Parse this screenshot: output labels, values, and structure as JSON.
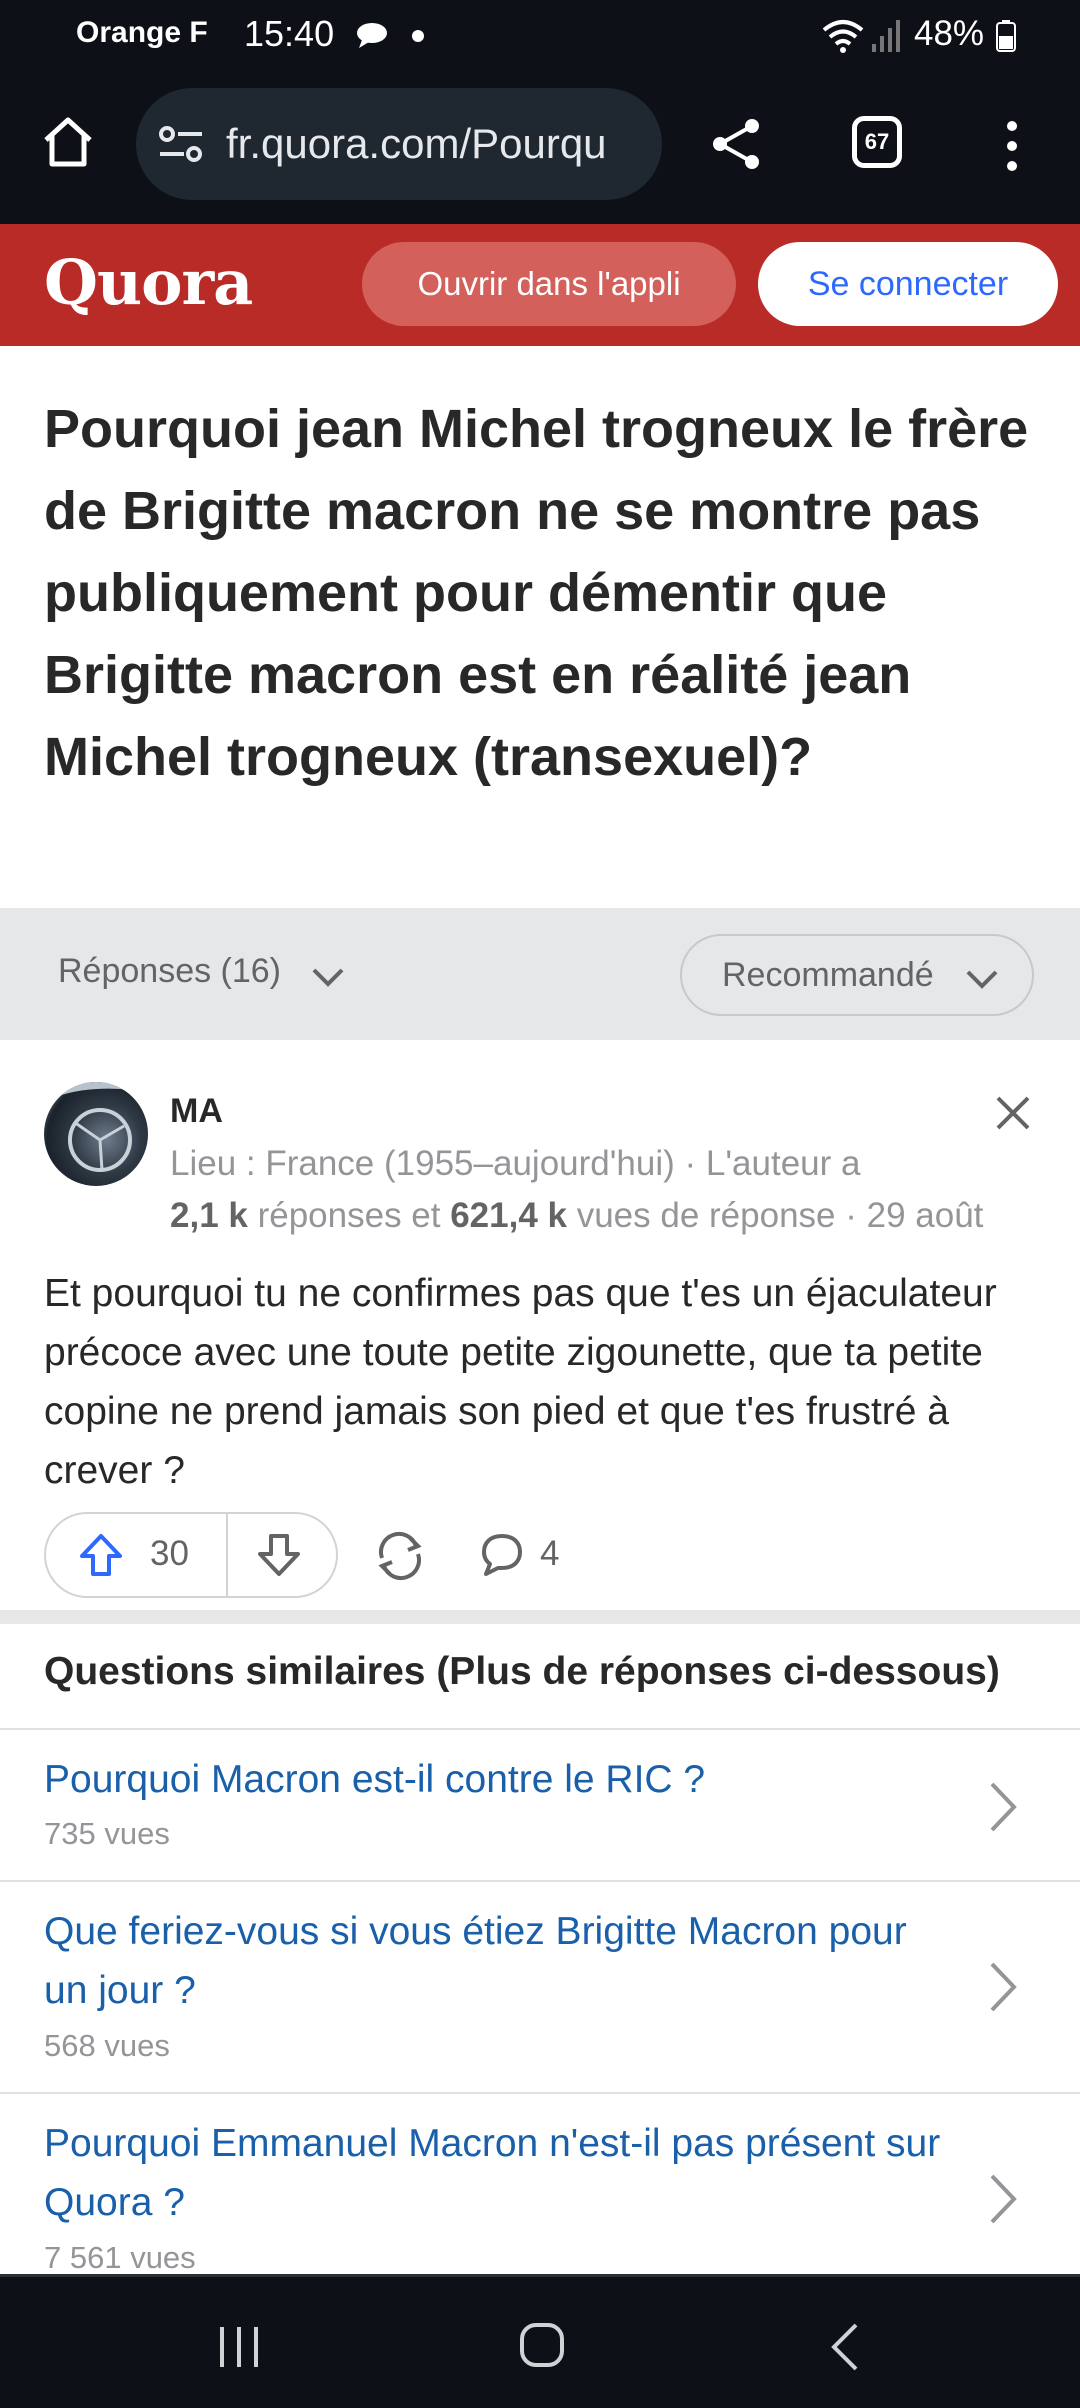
{
  "status_bar": {
    "carrier": "Orange F",
    "time": "15:40",
    "battery": "48%"
  },
  "browser": {
    "url": "fr.quora.com/Pourqu",
    "tab_count": "67"
  },
  "header": {
    "logo": "Quora",
    "open_app": "Ouvrir dans l'appli",
    "login": "Se connecter"
  },
  "question": {
    "title": "Pourquoi jean Michel trogneux le frère de Brigitte macron ne se montre pas publiquement pour démentir que Brigitte macron est en réalité jean Michel trogneux (transexuel)?"
  },
  "sort_bar": {
    "answers": "Réponses (16)",
    "sort": "Recommandé"
  },
  "answer": {
    "author": "MA",
    "credential": "Lieu : France (1955–aujourd'hui) · L'auteur a",
    "answers_count": "2,1 k",
    "answers_label": " réponses et ",
    "views_count": "621,4 k",
    "views_label": " vues de réponse · 29 août",
    "text": "Et pourquoi tu ne confirmes pas que t'es un éjaculateur précoce avec une toute petite zigounette, que ta petite copine ne prend jamais son pied et que t'es frustré à crever ?",
    "upvotes": "30",
    "comments": "4"
  },
  "related": {
    "title": "Questions similaires (Plus de réponses ci-dessous)",
    "items": [
      {
        "question": "Pourquoi Macron est-il contre le RIC ?",
        "views": "735 vues"
      },
      {
        "question": "Que feriez-vous si vous étiez Brigitte Macron pour un jour ?",
        "views": "568 vues"
      },
      {
        "question": "Pourquoi Emmanuel Macron n'est-il pas présent sur Quora ?",
        "views": "7 561 vues"
      }
    ]
  },
  "colors": {
    "quora_red": "#b92b27",
    "link_blue": "#195faa",
    "login_blue": "#2e69ff",
    "upvote_blue": "#2e69ff"
  }
}
